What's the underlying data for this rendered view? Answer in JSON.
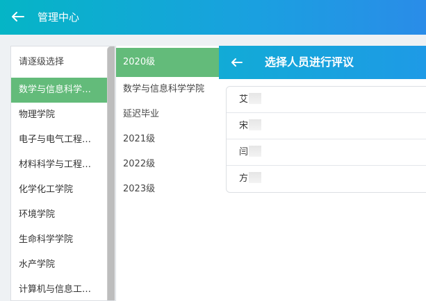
{
  "header": {
    "title": "管理中心"
  },
  "college_list": {
    "placeholder": "请逐级选择",
    "items": [
      "数学与信息科学学院",
      "物理学院",
      "电子与电气工程学院",
      "材料科学与工程学院",
      "化学化工学院",
      "环境学院",
      "生命科学学院",
      "水产学院",
      "计算机与信息工程学院"
    ],
    "active_index": 0
  },
  "grade_list": {
    "items": [
      "2020级",
      "数学与信息科学学院",
      "延迟毕业",
      "2021级",
      "2022级",
      "2023级"
    ],
    "active_index": 0
  },
  "evaluation_panel": {
    "title": "选择人员进行评议",
    "people": [
      {
        "visible_name": "艾"
      },
      {
        "visible_name": "宋"
      },
      {
        "visible_name": "闫"
      },
      {
        "visible_name": "方"
      }
    ]
  },
  "colors": {
    "header_gradient_start": "#05b5c6",
    "header_gradient_end": "#2a8ce8",
    "active_green": "#63bb7a"
  }
}
